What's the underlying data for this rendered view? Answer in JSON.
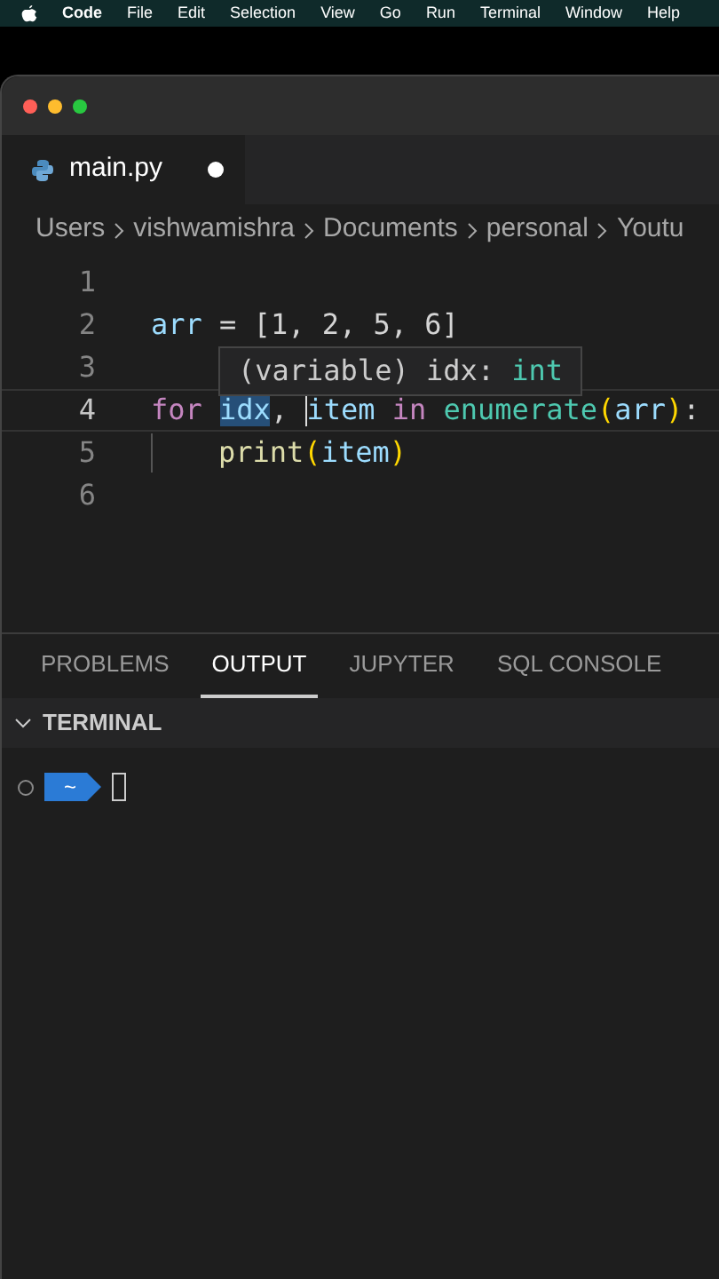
{
  "menu_bar": {
    "app": "Code",
    "items": [
      "File",
      "Edit",
      "Selection",
      "View",
      "Go",
      "Run",
      "Terminal",
      "Window",
      "Help"
    ]
  },
  "editor_tabs": [
    {
      "label": "main.py",
      "selected": true,
      "modified": true
    }
  ],
  "breadcrumbs": [
    "Users",
    "vishwamishra",
    "Documents",
    "personal",
    "Youtu"
  ],
  "code_lines": [
    {
      "number": "1",
      "current": false
    },
    {
      "number": "2",
      "current": false,
      "tokens": [
        {
          "text": "arr",
          "kind": "variable"
        },
        {
          "text": " = [1, 2, 5, 6]",
          "kind": "plain"
        }
      ]
    },
    {
      "number": "3",
      "current": false
    },
    {
      "number": "4",
      "current": true,
      "tokens": [
        {
          "text": "for ",
          "kind": "keyword"
        },
        {
          "text": "idx",
          "kind": "variable",
          "highlighted": true
        },
        {
          "text": ", ",
          "kind": "plain"
        },
        {
          "text": "item",
          "kind": "variable",
          "caret": true
        },
        {
          "text": " in ",
          "kind": "keyword"
        },
        {
          "text": "enumerate",
          "kind": "function"
        },
        {
          "text": "(",
          "kind": "bracket"
        },
        {
          "text": "arr",
          "kind": "variable"
        },
        {
          "text": ")",
          "kind": "bracket"
        },
        {
          "text": ":",
          "kind": "plain"
        }
      ]
    },
    {
      "number": "5",
      "current": false,
      "indent": true,
      "tokens": [
        {
          "text": "print",
          "kind": "builtin"
        },
        {
          "text": "(",
          "kind": "bracket"
        },
        {
          "text": "item",
          "kind": "variable"
        },
        {
          "text": ")",
          "kind": "bracket"
        }
      ]
    },
    {
      "number": "6",
      "current": false
    }
  ],
  "hover_tooltip": {
    "text": "(variable) idx: ",
    "type": "int"
  },
  "panel_tabs": [
    {
      "label": "PROBLEMS",
      "selected": false
    },
    {
      "label": "OUTPUT",
      "selected": true
    },
    {
      "label": "JUPYTER",
      "selected": false
    },
    {
      "label": "SQL CONSOLE",
      "selected": false
    }
  ],
  "terminal": {
    "title": "TERMINAL",
    "expanded": true,
    "prompt": "~"
  }
}
